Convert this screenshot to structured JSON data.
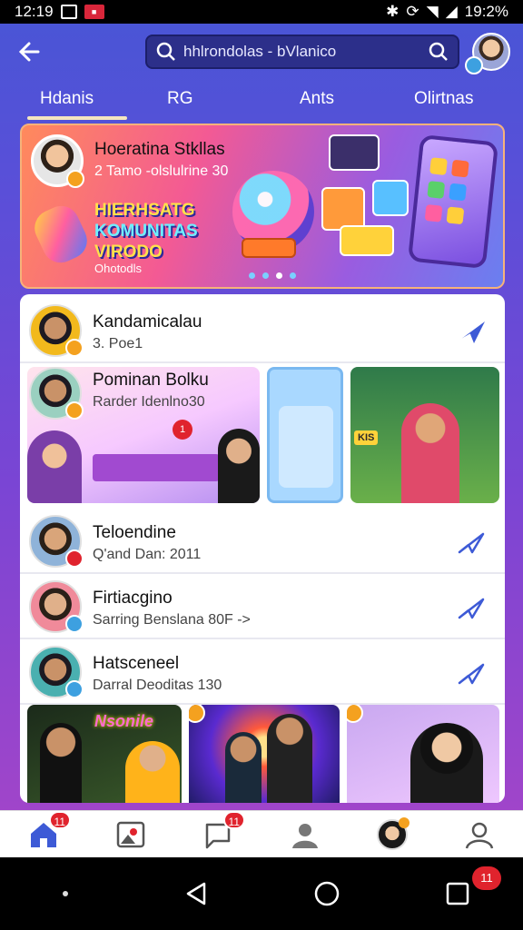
{
  "status_bar": {
    "time": "12:19",
    "icons": [
      "gallery-icon",
      "app-badge-icon"
    ],
    "right_icons": [
      "bluetooth-icon",
      "sync-icon",
      "wifi-icon",
      "signal-icon"
    ],
    "battery": "19:2%"
  },
  "header": {
    "search_placeholder": "hhlrondolas - bVlanico"
  },
  "tabs": [
    {
      "label": "Hdanis",
      "active": true
    },
    {
      "label": "RG"
    },
    {
      "label": "Ants"
    },
    {
      "label": "Olirtnas"
    }
  ],
  "banner": {
    "title": "Hoeratina Stkllas",
    "subtitle": "2 Tamo -olslulrine 30",
    "headline": [
      "HIERHSATG",
      "KOMUNITAS",
      "VIRODO"
    ],
    "caption": "Ohotodls"
  },
  "list": [
    {
      "title": "Kandamicalau",
      "subtitle": "3. Poe1",
      "action_icon": "send-plane-icon",
      "dot_color": "#f4a11f"
    },
    {
      "title": "Pominan Bolku",
      "subtitle": "Rarder Idenlno30",
      "dot_color": "#f4a11f"
    },
    {
      "title": "Teloendine",
      "subtitle": "Q'and Dan: 2011",
      "action_icon": "share-icon",
      "dot_color": "#e0232d"
    },
    {
      "title": "Firtiacgino",
      "subtitle": "Sarring Benslana 80F ->",
      "action_icon": "share-icon",
      "dot_color": "#3da0e0"
    },
    {
      "title": "Hatsceneel",
      "subtitle": "Darral Deoditas 130",
      "action_icon": "share-icon",
      "dot_color": "#3da0e0"
    }
  ],
  "media_labels": {
    "bottom_left": "Nsonile",
    "stage_sign": "KIS"
  },
  "bottom_nav": {
    "items": [
      {
        "icon": "home-icon",
        "badge": "11"
      },
      {
        "icon": "photo-icon",
        "badge": ""
      },
      {
        "icon": "chat-icon",
        "badge": "11"
      },
      {
        "icon": "profile-icon",
        "badge": ""
      },
      {
        "icon": "avatar-icon",
        "badge": ""
      },
      {
        "icon": "user-icon",
        "badge": ""
      }
    ]
  },
  "system_nav": {
    "recents_badge": "11"
  },
  "colors": {
    "accent": "#4a55d6",
    "badge": "#e0232d"
  }
}
